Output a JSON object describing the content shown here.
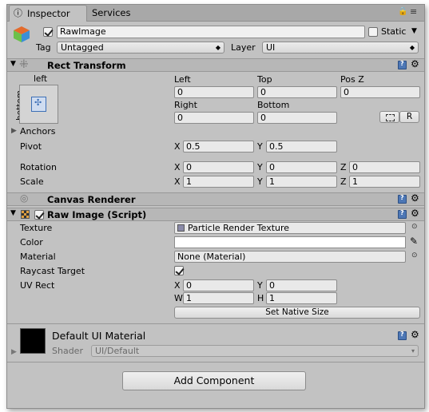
{
  "tabs": {
    "inspector": "Inspector",
    "services": "Services"
  },
  "object": {
    "name": "RawImage",
    "active": true,
    "static_label": "Static",
    "tag_label": "Tag",
    "tag_value": "Untagged",
    "layer_label": "Layer",
    "layer_value": "UI"
  },
  "rect_transform": {
    "title": "Rect Transform",
    "anchor_h": "left",
    "anchor_v": "bottom",
    "left_label": "Left",
    "left_value": "0",
    "top_label": "Top",
    "top_value": "0",
    "posz_label": "Pos Z",
    "posz_value": "0",
    "right_label": "Right",
    "right_value": "0",
    "bottom_label": "Bottom",
    "bottom_value": "0",
    "r_button": "R",
    "anchors_label": "Anchors",
    "pivot_label": "Pivot",
    "pivot_x": "0.5",
    "pivot_y": "0.5",
    "rotation_label": "Rotation",
    "rot_x": "0",
    "rot_y": "0",
    "rot_z": "0",
    "scale_label": "Scale",
    "scale_x": "1",
    "scale_y": "1",
    "scale_z": "1",
    "x": "X",
    "y": "Y",
    "z": "Z"
  },
  "canvas_renderer": {
    "title": "Canvas Renderer"
  },
  "raw_image": {
    "title": "Raw Image (Script)",
    "enabled": true,
    "texture_label": "Texture",
    "texture_value": "Particle Render Texture",
    "color_label": "Color",
    "color_value": "#ffffff",
    "material_label": "Material",
    "material_value": "None (Material)",
    "raycast_label": "Raycast Target",
    "raycast_value": true,
    "uvrect_label": "UV Rect",
    "uv_x": "0",
    "uv_y": "0",
    "uv_w": "1",
    "uv_h": "1",
    "w": "W",
    "h": "H",
    "native_button": "Set Native Size"
  },
  "material": {
    "name": "Default UI Material",
    "shader_label": "Shader",
    "shader_value": "UI/Default"
  },
  "add_component": "Add Component",
  "icons": {
    "lock": "lock-icon",
    "menu": "menu-icon",
    "help": "help-book-icon",
    "settings": "gear-icon"
  }
}
